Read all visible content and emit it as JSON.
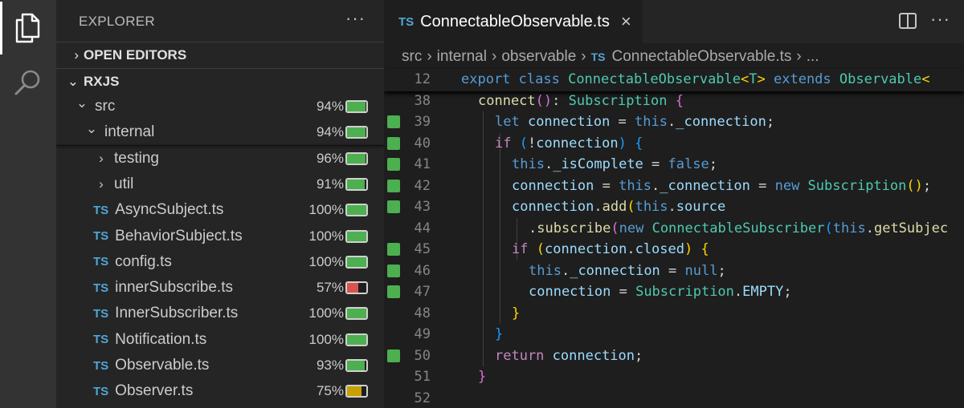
{
  "sidebar": {
    "title": "EXPLORER",
    "more": "···",
    "open_editors": "OPEN EDITORS",
    "project": "RXJS",
    "tree": [
      {
        "label": "src",
        "indent": 1,
        "chevron": "down",
        "is_ts": false,
        "coverage": "94%",
        "fraction": 0.94,
        "color": "#4caf50"
      },
      {
        "label": "internal",
        "indent": 2,
        "chevron": "down",
        "is_ts": false,
        "coverage": "94%",
        "fraction": 0.94,
        "color": "#4caf50"
      },
      {
        "label": "testing",
        "indent": 3,
        "chevron": "right",
        "is_ts": false,
        "coverage": "96%",
        "fraction": 0.96,
        "color": "#4caf50"
      },
      {
        "label": "util",
        "indent": 3,
        "chevron": "right",
        "is_ts": false,
        "coverage": "91%",
        "fraction": 0.91,
        "color": "#4caf50"
      },
      {
        "label": "AsyncSubject.ts",
        "indent": 3,
        "is_ts": true,
        "coverage": "100%",
        "fraction": 1.0,
        "color": "#4caf50"
      },
      {
        "label": "BehaviorSubject.ts",
        "indent": 3,
        "is_ts": true,
        "coverage": "100%",
        "fraction": 1.0,
        "color": "#4caf50"
      },
      {
        "label": "config.ts",
        "indent": 3,
        "is_ts": true,
        "coverage": "100%",
        "fraction": 1.0,
        "color": "#4caf50"
      },
      {
        "label": "innerSubscribe.ts",
        "indent": 3,
        "is_ts": true,
        "coverage": "57%",
        "fraction": 0.57,
        "color": "#d9534f"
      },
      {
        "label": "InnerSubscriber.ts",
        "indent": 3,
        "is_ts": true,
        "coverage": "100%",
        "fraction": 1.0,
        "color": "#4caf50"
      },
      {
        "label": "Notification.ts",
        "indent": 3,
        "is_ts": true,
        "coverage": "100%",
        "fraction": 1.0,
        "color": "#4caf50"
      },
      {
        "label": "Observable.ts",
        "indent": 3,
        "is_ts": true,
        "coverage": "93%",
        "fraction": 0.93,
        "color": "#4caf50"
      },
      {
        "label": "Observer.ts",
        "indent": 3,
        "is_ts": true,
        "coverage": "75%",
        "fraction": 0.75,
        "color": "#c8a000"
      }
    ],
    "ts_badge": "TS"
  },
  "editor": {
    "tab": {
      "badge": "TS",
      "name": "ConnectableObservable.ts",
      "close": "×"
    },
    "more": "···",
    "breadcrumbs": [
      "src",
      "internal",
      "observable"
    ],
    "breadcrumb_file": "ConnectableObservable.ts",
    "breadcrumb_tail": "...",
    "code": [
      {
        "ln": "12",
        "cov": false,
        "sticky": true,
        "indent": 0,
        "tokens": [
          [
            "k",
            "export "
          ],
          [
            "k",
            "class "
          ],
          [
            "t",
            "ConnectableObservable"
          ],
          [
            "b1",
            "<"
          ],
          [
            "t",
            "T"
          ],
          [
            "b1",
            "> "
          ],
          [
            "k",
            "extends "
          ],
          [
            "t",
            "Observable"
          ],
          [
            "b1",
            "<"
          ]
        ]
      },
      {
        "ln": "38",
        "cov": false,
        "indent": 1,
        "tokens": [
          [
            "f",
            "connect"
          ],
          [
            "b2",
            "()"
          ],
          [
            "p",
            ": "
          ],
          [
            "t",
            "Subscription "
          ],
          [
            "b2",
            "{"
          ]
        ]
      },
      {
        "ln": "39",
        "cov": true,
        "indent": 2,
        "tokens": [
          [
            "k",
            "let "
          ],
          [
            "v",
            "connection "
          ],
          [
            "p",
            "= "
          ],
          [
            "k",
            "this"
          ],
          [
            "p",
            "."
          ],
          [
            "v",
            "_connection"
          ],
          [
            "p",
            ";"
          ]
        ]
      },
      {
        "ln": "40",
        "cov": true,
        "indent": 2,
        "tokens": [
          [
            "kc",
            "if "
          ],
          [
            "b3",
            "("
          ],
          [
            "p",
            "!"
          ],
          [
            "v",
            "connection"
          ],
          [
            "b3",
            ") "
          ],
          [
            "b3",
            "{"
          ]
        ]
      },
      {
        "ln": "41",
        "cov": true,
        "indent": 3,
        "tokens": [
          [
            "k",
            "this"
          ],
          [
            "p",
            "."
          ],
          [
            "v",
            "_isComplete "
          ],
          [
            "p",
            "= "
          ],
          [
            "k",
            "false"
          ],
          [
            "p",
            ";"
          ]
        ]
      },
      {
        "ln": "42",
        "cov": true,
        "indent": 3,
        "tokens": [
          [
            "v",
            "connection "
          ],
          [
            "p",
            "= "
          ],
          [
            "k",
            "this"
          ],
          [
            "p",
            "."
          ],
          [
            "v",
            "_connection "
          ],
          [
            "p",
            "= "
          ],
          [
            "k",
            "new "
          ],
          [
            "t",
            "Subscription"
          ],
          [
            "b1",
            "()"
          ],
          [
            "p",
            ";"
          ]
        ]
      },
      {
        "ln": "43",
        "cov": true,
        "indent": 3,
        "tokens": [
          [
            "v",
            "connection"
          ],
          [
            "p",
            "."
          ],
          [
            "f",
            "add"
          ],
          [
            "b1",
            "("
          ],
          [
            "k",
            "this"
          ],
          [
            "p",
            "."
          ],
          [
            "v",
            "source"
          ]
        ]
      },
      {
        "ln": "44",
        "cov": false,
        "indent": 4,
        "tokens": [
          [
            "p",
            "."
          ],
          [
            "f",
            "subscribe"
          ],
          [
            "b2",
            "("
          ],
          [
            "k",
            "new "
          ],
          [
            "t",
            "ConnectableSubscriber"
          ],
          [
            "b3",
            "("
          ],
          [
            "k",
            "this"
          ],
          [
            "p",
            "."
          ],
          [
            "f",
            "getSubjec"
          ]
        ]
      },
      {
        "ln": "45",
        "cov": true,
        "indent": 3,
        "tokens": [
          [
            "kc",
            "if "
          ],
          [
            "b1",
            "("
          ],
          [
            "v",
            "connection"
          ],
          [
            "p",
            "."
          ],
          [
            "v",
            "closed"
          ],
          [
            "b1",
            ") "
          ],
          [
            "b1",
            "{"
          ]
        ]
      },
      {
        "ln": "46",
        "cov": true,
        "indent": 4,
        "tokens": [
          [
            "k",
            "this"
          ],
          [
            "p",
            "."
          ],
          [
            "v",
            "_connection "
          ],
          [
            "p",
            "= "
          ],
          [
            "k",
            "null"
          ],
          [
            "p",
            ";"
          ]
        ]
      },
      {
        "ln": "47",
        "cov": true,
        "indent": 4,
        "tokens": [
          [
            "v",
            "connection "
          ],
          [
            "p",
            "= "
          ],
          [
            "t",
            "Subscription"
          ],
          [
            "p",
            "."
          ],
          [
            "v",
            "EMPTY"
          ],
          [
            "p",
            ";"
          ]
        ]
      },
      {
        "ln": "48",
        "cov": false,
        "indent": 3,
        "tokens": [
          [
            "b1",
            "}"
          ]
        ]
      },
      {
        "ln": "49",
        "cov": false,
        "indent": 2,
        "tokens": [
          [
            "b3",
            "}"
          ]
        ]
      },
      {
        "ln": "50",
        "cov": true,
        "indent": 2,
        "tokens": [
          [
            "kc",
            "return "
          ],
          [
            "v",
            "connection"
          ],
          [
            "p",
            ";"
          ]
        ]
      },
      {
        "ln": "51",
        "cov": false,
        "indent": 1,
        "tokens": [
          [
            "b2",
            "}"
          ]
        ]
      },
      {
        "ln": "52",
        "cov": false,
        "indent": 0,
        "tokens": []
      }
    ]
  },
  "colors": {
    "ts_badge": "#4fa7d6",
    "coverage_green": "#4caf50",
    "coverage_red": "#d9534f",
    "coverage_yellow": "#c8a000"
  },
  "icons": [
    "files-icon",
    "search-icon",
    "split-editor-icon",
    "close-icon",
    "chevron-right-icon",
    "chevron-down-icon",
    "more-icon"
  ]
}
